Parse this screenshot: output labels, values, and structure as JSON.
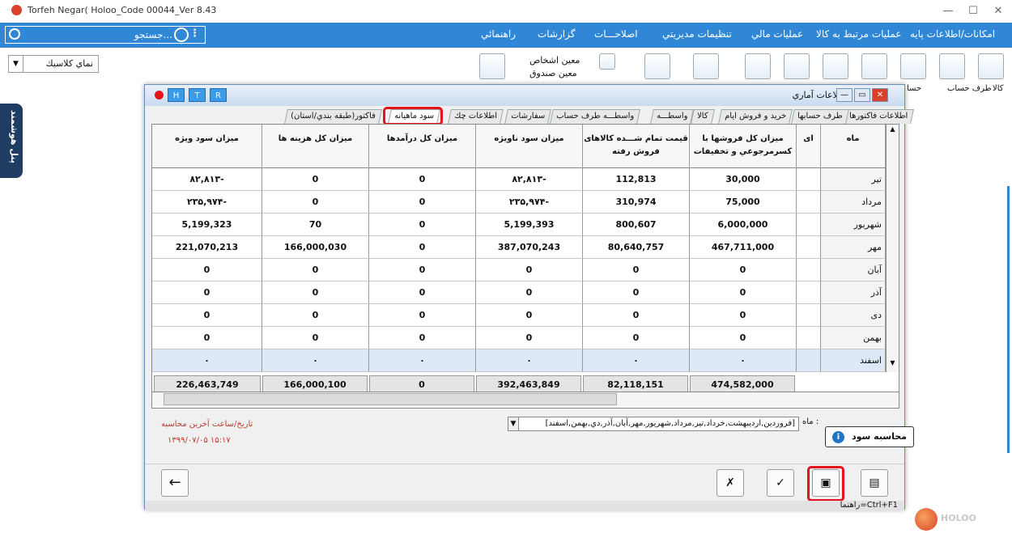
{
  "window": {
    "title": "Torfeh Negar( Holoo_Code 00044_Ver 8.43",
    "minimize": "—",
    "maximize": "☐",
    "close": "✕"
  },
  "menubar": {
    "search_label": "جستجو...",
    "items": [
      "امکانات/اطلاعات پایه",
      "عملیات مرتبط به کالا",
      "عملیات مالي",
      "تنظیمات مدیریتي",
      "اصلاحـــات",
      "گزارشات",
      "راهنمائي"
    ]
  },
  "toolbar": {
    "theme": "نماي كلاسيك",
    "labels": [
      "كالا",
      "طرف حساب",
      "حسا"
    ],
    "menu_items": [
      "معين اشخاص",
      "معين صندوق"
    ]
  },
  "side_tab": "پنل هوشمند",
  "dialog": {
    "title": "اطلاعات آماري",
    "htr": [
      "H",
      "T",
      "R"
    ],
    "tabs": [
      "اطلاعات فاكتورها",
      "طرف حسابها",
      "خريد و فروش ايام",
      "كالا",
      "واسطـــه",
      "واسطـــه طرف حساب",
      "سفارشات",
      "اطلاعات چك",
      "سود ماهيانه",
      "فاكتور(طبقه بندي/استان)"
    ],
    "columns": [
      "ماه",
      "ای",
      "ميزان كل فروشها با كسرمرجوعي و تخفيفات",
      "قيمت تمام شـــده كالاهای فروش رفته",
      "ميزان سود ناويژه",
      "ميزان كل درآمدها",
      "ميزان كل هزينه ها",
      "ميزان سود ويژه"
    ],
    "rows": [
      {
        "month": "تیر",
        "sales": "30,000",
        "cost": "112,813",
        "gross": "۸۲,۸۱۳-",
        "income": "0",
        "expense": "0",
        "net": "۸۲,۸۱۳-"
      },
      {
        "month": "مرداد",
        "sales": "75,000",
        "cost": "310,974",
        "gross": "۲۳۵,۹۷۴-",
        "income": "0",
        "expense": "0",
        "net": "۲۳۵,۹۷۴-"
      },
      {
        "month": "شهریور",
        "sales": "6,000,000",
        "cost": "800,607",
        "gross": "5,199,393",
        "income": "0",
        "expense": "70",
        "net": "5,199,323"
      },
      {
        "month": "مهر",
        "sales": "467,711,000",
        "cost": "80,640,757",
        "gross": "387,070,243",
        "income": "0",
        "expense": "166,000,030",
        "net": "221,070,213"
      },
      {
        "month": "آبان",
        "sales": "0",
        "cost": "0",
        "gross": "0",
        "income": "0",
        "expense": "0",
        "net": "0"
      },
      {
        "month": "آذر",
        "sales": "0",
        "cost": "0",
        "gross": "0",
        "income": "0",
        "expense": "0",
        "net": "0"
      },
      {
        "month": "دی",
        "sales": "0",
        "cost": "0",
        "gross": "0",
        "income": "0",
        "expense": "0",
        "net": "0"
      },
      {
        "month": "بهمن",
        "sales": "0",
        "cost": "0",
        "gross": "0",
        "income": "0",
        "expense": "0",
        "net": "0"
      },
      {
        "month": "اسفند",
        "sales": "۰",
        "cost": "۰",
        "gross": "۰",
        "income": "۰",
        "expense": "۰",
        "net": "۰"
      }
    ],
    "totals": {
      "sales": "474,582,000",
      "cost": "82,118,151",
      "gross": "392,463,849",
      "income": "0",
      "expense": "166,000,100",
      "net": "226,463,749"
    },
    "last_calc_label": "تاريخ/ساعت آخرين محاسبه",
    "last_calc_value": "۱۳۹۹/۰۷/۰۵   ۱۵:۱۷",
    "month_label": "ماه :",
    "months_value": "[فروردين,ارديبهشت,خرداد,تير,مرداد,شهريور,مهر,آبان,آذر,دي,بهمن,اسفند]",
    "tooltip": "محاسبه سود",
    "help": "راهنما=Ctrl+F1"
  },
  "logo": "HOLOO"
}
